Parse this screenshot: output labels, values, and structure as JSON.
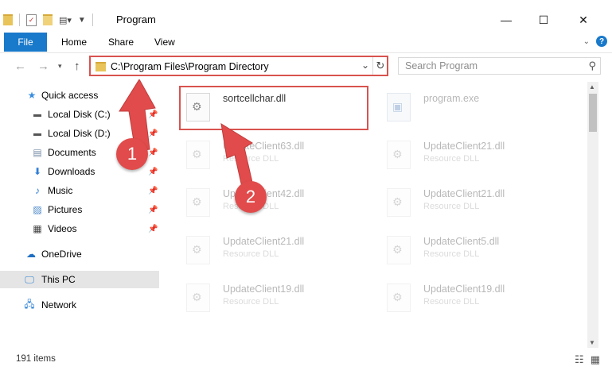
{
  "window": {
    "title": "Program"
  },
  "ribbon": {
    "file": "File",
    "home": "Home",
    "share": "Share",
    "view": "View",
    "help_icon": "?"
  },
  "address": {
    "path": "C:\\Program Files\\Program Directory"
  },
  "search": {
    "placeholder": "Search Program"
  },
  "sidebar": {
    "quick_access": "Quick access",
    "items": [
      {
        "label": "Local Disk (C:)",
        "icon": "disk-icon"
      },
      {
        "label": "Local Disk (D:)",
        "icon": "disk-icon"
      },
      {
        "label": "Documents",
        "icon": "documents-icon"
      },
      {
        "label": "Downloads",
        "icon": "downloads-icon"
      },
      {
        "label": "Music",
        "icon": "music-icon"
      },
      {
        "label": "Pictures",
        "icon": "pictures-icon"
      },
      {
        "label": "Videos",
        "icon": "videos-icon"
      }
    ],
    "onedrive": "OneDrive",
    "this_pc": "This PC",
    "network": "Network"
  },
  "files": {
    "highlighted": {
      "name": "sortcellchar.dll"
    },
    "exe": {
      "name": "program.exe"
    },
    "dll_type": "Resource DLL",
    "left_column": [
      "UpdateClient63.dll",
      "UpdateClient42.dll",
      "UpdateClient21.dll",
      "UpdateClient19.dll"
    ],
    "right_column": [
      "UpdateClient21.dll",
      "UpdateClient21.dll",
      "UpdateClient5.dll",
      "UpdateClient19.dll"
    ]
  },
  "status": {
    "count": "191 items"
  },
  "callouts": [
    "1",
    "2"
  ],
  "colors": {
    "accent": "#1979ca",
    "highlight": "#d9534f",
    "callout": "#e14b4b"
  }
}
